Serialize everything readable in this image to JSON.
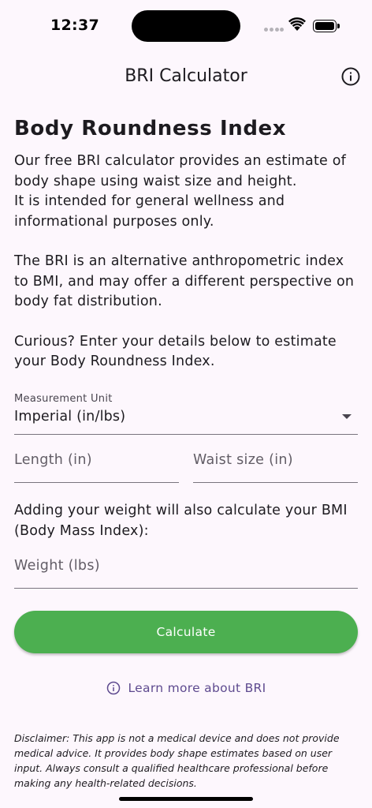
{
  "status_bar": {
    "time": "12:37"
  },
  "app_bar": {
    "title": "BRI Calculator",
    "info_icon": "info-icon"
  },
  "content": {
    "title": "Body Roundness Index",
    "intro_lines": [
      "Our free BRI calculator provides an estimate of body shape using waist size and height.",
      "It is intended for general wellness and informational purposes only.",
      "The BRI is an alternative anthropometric index to BMI, and may offer a different perspective on body fat distribution.",
      "Curious? Enter your details below to estimate your Body Roundness Index."
    ]
  },
  "form": {
    "unit_label": "Measurement Unit",
    "unit_value": "Imperial (in/lbs)",
    "length_placeholder": "Length (in)",
    "waist_placeholder": "Waist size (in)",
    "weight_note": "Adding your weight will also calculate your BMI (Body Mass Index):",
    "weight_placeholder": "Weight (lbs)",
    "calculate_label": "Calculate"
  },
  "learn_more": {
    "label": "Learn more about BRI",
    "icon": "info-icon"
  },
  "disclaimer": "Disclaimer: This app is not a medical device and does not provide medical advice. It provides body shape estimates based on user input. Always consult a qualified healthcare professional before making any health-related decisions.",
  "colors": {
    "background": "#fdf7fd",
    "primary_button": "#4caf50",
    "link": "#5e4a8f"
  }
}
